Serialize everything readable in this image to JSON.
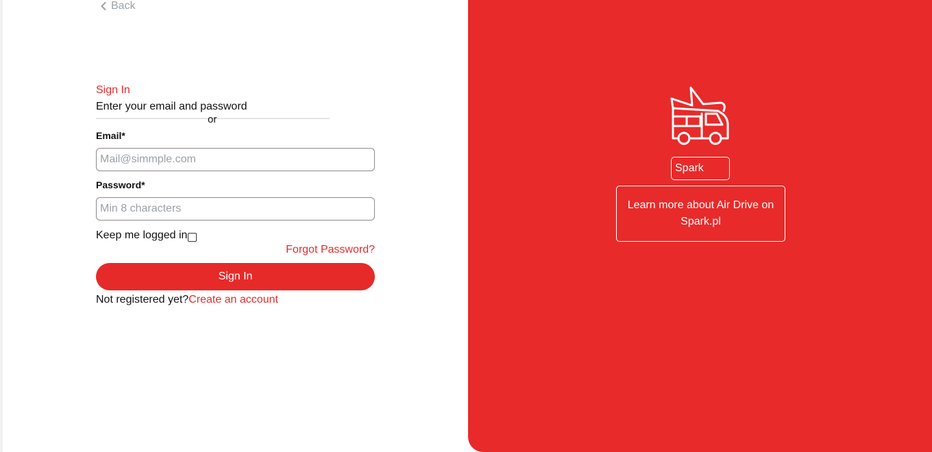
{
  "nav": {
    "back_label": "Back"
  },
  "form": {
    "heading": "Sign In",
    "subtitle": "Enter your email and password",
    "divider_text": "or",
    "email_label": "Email*",
    "email_placeholder": "Mail@simmple.com",
    "password_label": "Password*",
    "password_placeholder": "Min 8 characters",
    "keep_logged_in": "Keep me logged in",
    "forgot_password": "Forgot Password?",
    "submit_label": "Sign In",
    "not_registered": "Not registered yet?",
    "create_account": "Create an account"
  },
  "brand": {
    "icon": "bus-icon",
    "name": "Spark",
    "learn_more": "Learn more about Air Drive on Spark.pl"
  },
  "colors": {
    "accent": "#e62a2a",
    "panel": "#e82a2a"
  }
}
